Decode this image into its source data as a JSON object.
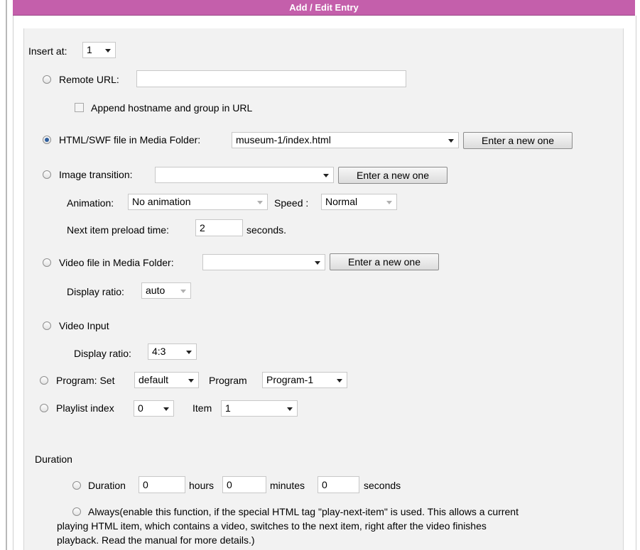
{
  "header": {
    "title": "Add / Edit Entry"
  },
  "insert_at": {
    "label": "Insert at:",
    "value": "1"
  },
  "remote_url": {
    "label": "Remote URL:",
    "value": "",
    "append_label": "Append hostname and group in URL"
  },
  "html_swf": {
    "label": "HTML/SWF file in Media Folder:",
    "value": "museum-1/index.html",
    "button": "Enter a new one"
  },
  "image_transition": {
    "label": "Image transition:",
    "value": "",
    "button": "Enter a new one",
    "animation_label": "Animation:",
    "animation_value": "No animation",
    "speed_label": "Speed :",
    "speed_value": "Normal",
    "preload_label": "Next item preload time:",
    "preload_value": "2",
    "preload_unit": "seconds."
  },
  "video_file": {
    "label": "Video file in Media Folder:",
    "value": "",
    "button": "Enter a new one",
    "ratio_label": "Display ratio:",
    "ratio_value": "auto"
  },
  "video_input": {
    "label": "Video Input",
    "ratio_label": "Display ratio:",
    "ratio_value": "4:3"
  },
  "program": {
    "label": "Program: Set",
    "set_value": "default",
    "program_label": "Program",
    "program_value": "Program-1"
  },
  "playlist": {
    "label": "Playlist index",
    "index_value": "0",
    "item_label": "Item",
    "item_value": "1"
  },
  "duration": {
    "section_label": "Duration",
    "option_label": "Duration",
    "hours_value": "0",
    "hours_label": "hours",
    "minutes_value": "0",
    "minutes_label": "minutes",
    "seconds_value": "0",
    "seconds_label": "seconds",
    "always_line1": "Always(enable this function, if the special HTML tag \"play-next-item\" is used. This allows a current",
    "always_line2": "playing HTML item, which contains a video, switches to the next item, right after the video finishes",
    "always_line3": "playback. Read the manual for more details.)"
  }
}
